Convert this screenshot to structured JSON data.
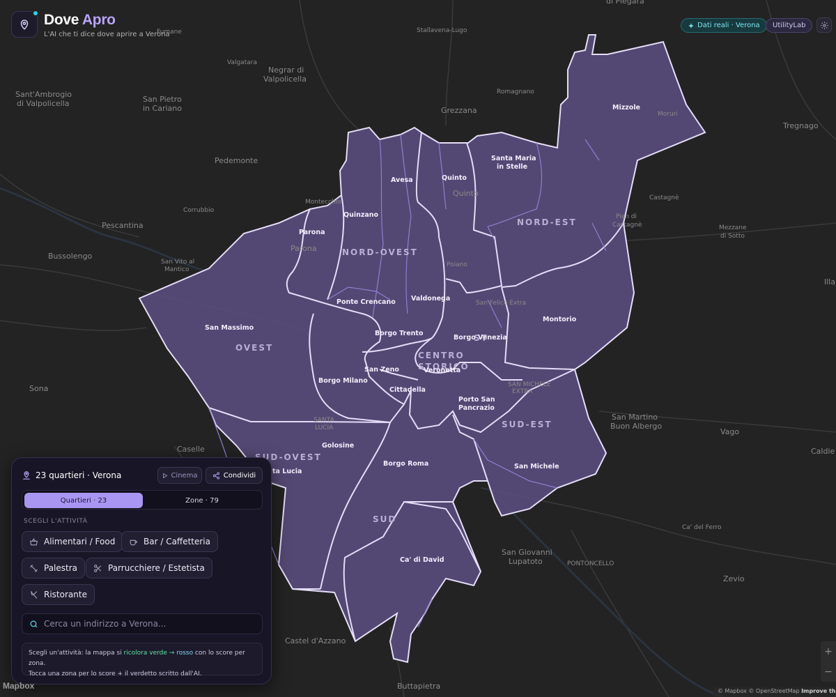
{
  "header": {
    "brand_main": "Dove",
    "brand_accent": "Apro",
    "tagline": "L'AI che ti dice dove aprire a Verona",
    "badge_real": "Dati reali · Verona",
    "badge_lab": "UtilityLab",
    "settings_icon": "gear-icon"
  },
  "panel": {
    "title": "23 quartieri · Verona",
    "cinema_label": "Cinema",
    "share_label": "Condividi",
    "segment_quartieri": "Quartieri · 23",
    "segment_zone": "Zone · 79",
    "section_label": "SCEGLI L'ATTIVITÀ",
    "activities": {
      "food": "Alimentari / Food",
      "bar": "Bar / Caffetteria",
      "gym": "Palestra",
      "hair": "Parrucchiere / Estetista",
      "restaurant": "Ristorante"
    },
    "search_placeholder": "Cerca un indirizzo a Verona...",
    "hint": {
      "part1": "Scegli un'attività: la mappa si ",
      "green": "ricolora verde",
      "arrow": " → ",
      "red": "rosso",
      "part2": " con lo score per zona.",
      "line2": "Tocca una zona per lo score + il verdetto scritto dall'AI."
    }
  },
  "map": {
    "colors": {
      "district_fill": "#5a4d7e",
      "district_stroke": "#e4ddf7",
      "inner_stroke": "#8e7fd1"
    },
    "macro_areas": {
      "nord_ovest": "NORD-OVEST",
      "nord_est": "NORD-EST",
      "ovest": "OVEST",
      "centro_1": "CENTRO",
      "centro_2": "STORICO",
      "sud_ovest": "SUD-OVEST",
      "sud_est": "SUD-EST",
      "sud": "SUD",
      "est_fragment": "ST"
    },
    "quartieri": {
      "mizzole": "Mizzole",
      "santa_maria_1": "Santa Maria",
      "santa_maria_2": "in Stelle",
      "quinto": "Quinto",
      "avesa": "Avesa",
      "quinzano": "Quinzano",
      "parona": "Parona",
      "ponte_crencano": "Ponte Crencano",
      "valdonega": "Valdonega",
      "montorio": "Montorio",
      "san_massimo": "San Massimo",
      "borgo_trento": "Borgo Trento",
      "borgo_venezia": "Borgo Venezia",
      "san_zeno": "San Zeno",
      "veronetta": "Veronetta",
      "borgo_milano": "Borgo Milano",
      "cittadella": "Cittadella",
      "porto_san_pancrazio_1": "Porto San",
      "porto_san_pancrazio_2": "Pancrazio",
      "golosine": "Golosine",
      "borgo_roma": "Borgo Roma",
      "san_michele": "San Michele",
      "ca_di_david": "Ca' di David",
      "santa_lucia": "ta Lucia"
    },
    "places": {
      "piegara": "di Piegara",
      "stallavena": "Stallavena-Lugo",
      "valgatara": "Valgatara",
      "negrar_1": "Negrar di",
      "negrar_2": "Valpolicella",
      "romagnano": "Romagnano",
      "grezzana": "Grezzana",
      "tregnago": "Tregnago",
      "sant_ambrogio_1": "Sant'Ambrogio",
      "sant_ambrogio_2": "di Valpolicella",
      "san_pietro_1": "San Pietro",
      "san_pietro_2": "in Cariano",
      "pedemonte": "Pedemonte",
      "moruri": "Moruri",
      "montecchio": "Montecchio",
      "corrubbio": "Corrubbio",
      "pescantina": "Pescantina",
      "castagne": "Castagnè",
      "poiano": "Poiano",
      "pian_1": "Pian di",
      "pian_2": "Castagnè",
      "mezzane_1": "Mezzane",
      "mezzane_2": "di Sotto",
      "bussolengo": "Bussolengo",
      "san_vito_1": "San Vito al",
      "san_vito_2": "Mantico",
      "quinto_ghost": "Quinto",
      "parona_ghost": "Parona",
      "illa": "Illa",
      "san_felice": "San Felice Extra",
      "sona": "Sona",
      "san_michele_extra_1": "SAN MICHELE",
      "san_michele_extra_2": "EXTRA",
      "san_martino_1": "San Martino",
      "san_martino_2": "Buon Albergo",
      "vago": "Vago",
      "caldiero": "Caldie",
      "caselle": "Caselle",
      "santa_lucia_ghost_1": "SANTA",
      "santa_lucia_ghost_2": "LUCIA",
      "ca_del_ferro": "Ca' del Ferro",
      "san_giovanni_1": "San Giovanni",
      "san_giovanni_2": "Lupatoto",
      "pontoncello": "PONTONCELLO",
      "zevio": "Zevio",
      "castel_dazzano": "Castel d'Azzano",
      "buttapietra": "Buttapietra",
      "fumane": "Fumane"
    }
  },
  "footer": {
    "mapbox_logo": "Mapbox",
    "attribution_prefix": "© Mapbox © OpenStreetMap",
    "attribution_link": "Improve this m",
    "zoom_in": "+",
    "zoom_out": "−"
  }
}
